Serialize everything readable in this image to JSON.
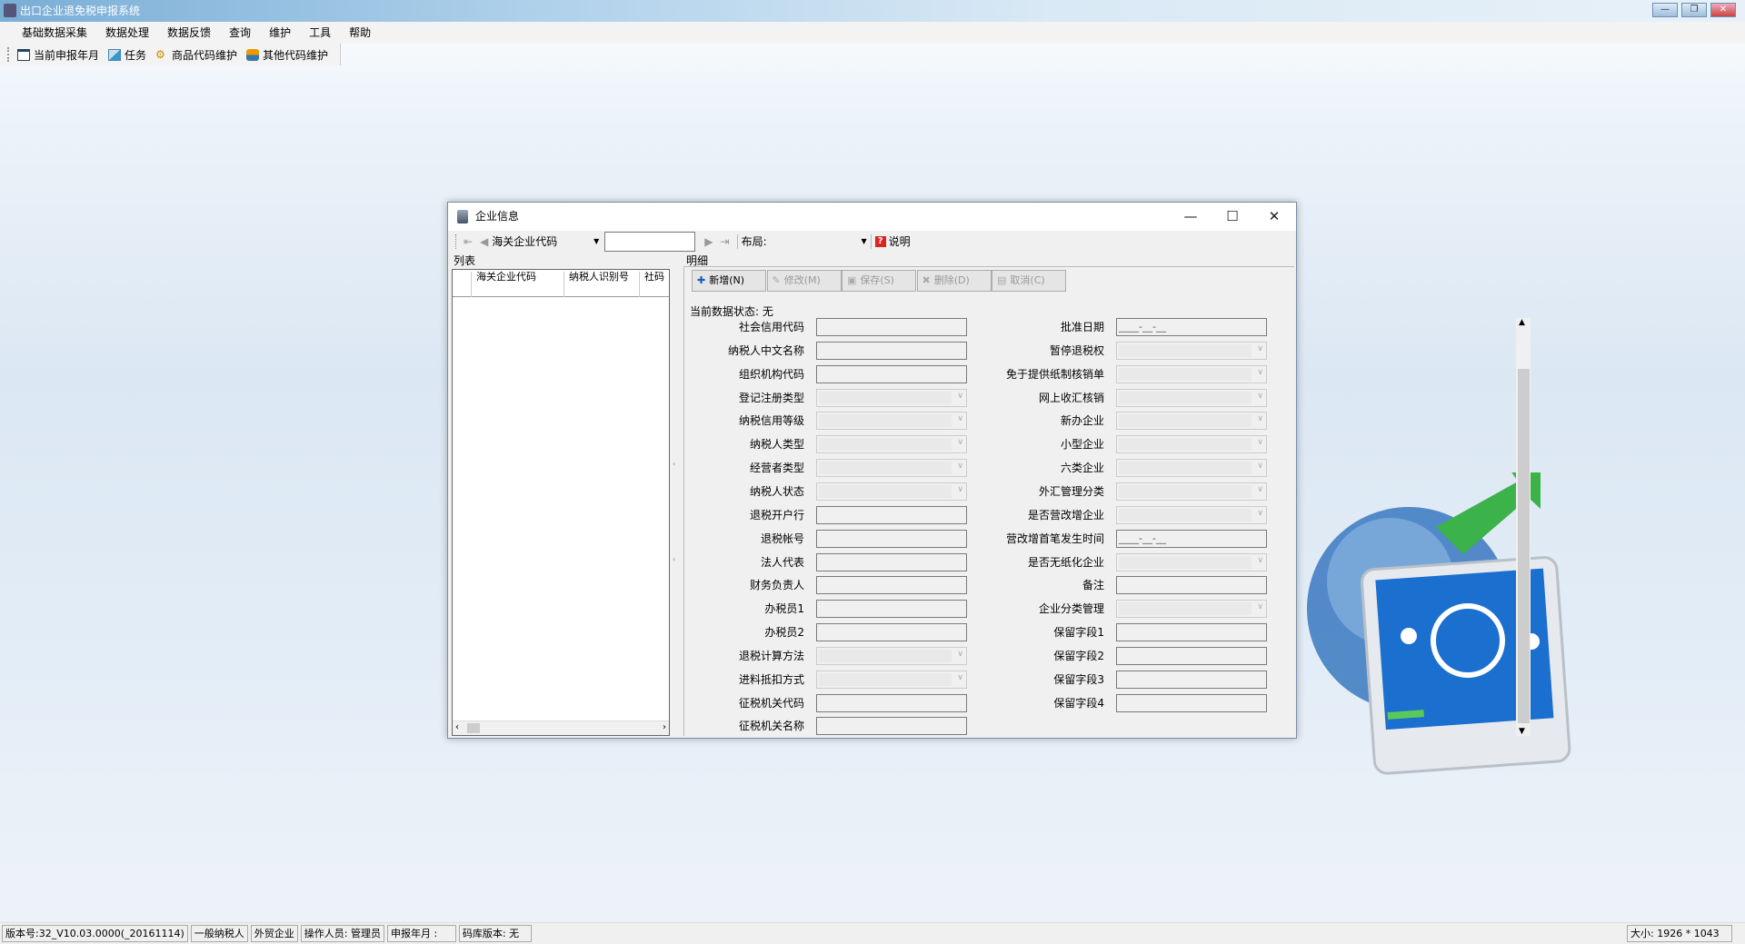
{
  "app": {
    "title": "出口企业退免税申报系统",
    "min": "—",
    "restore": "❐",
    "close": "✕"
  },
  "menu": [
    "基础数据采集",
    "数据处理",
    "数据反馈",
    "查询",
    "维护",
    "工具",
    "帮助"
  ],
  "toolbar": [
    {
      "label": "当前申报年月",
      "icon": "calendar-icon"
    },
    {
      "label": "任务",
      "icon": "task-icon"
    },
    {
      "label": "商品代码维护",
      "icon": "gear-icon"
    },
    {
      "label": "其他代码维护",
      "icon": "tools-icon"
    }
  ],
  "dialog": {
    "title": "企业信息",
    "search_field": "海关企业代码",
    "search_value": "",
    "layout_label": "布局:",
    "layout_value": "",
    "help_label": "说明",
    "list_label": "列表",
    "list_columns": [
      "海关企业代码",
      "纳税人识别号",
      "社码"
    ],
    "detail_label": "明细",
    "actions": [
      {
        "label": "新增(N)",
        "enabled": true,
        "icon": "plus-icon"
      },
      {
        "label": "修改(M)",
        "enabled": false,
        "icon": "edit-icon"
      },
      {
        "label": "保存(S)",
        "enabled": false,
        "icon": "save-icon"
      },
      {
        "label": "删除(D)",
        "enabled": false,
        "icon": "delete-icon"
      },
      {
        "label": "取消(C)",
        "enabled": false,
        "icon": "cancel-icon"
      }
    ],
    "status": "当前数据状态: 无",
    "left_fields": [
      {
        "label": "社会信用代码",
        "type": "text",
        "value": ""
      },
      {
        "label": "纳税人中文名称",
        "type": "text",
        "value": ""
      },
      {
        "label": "组织机构代码",
        "type": "text",
        "value": ""
      },
      {
        "label": "登记注册类型",
        "type": "combo",
        "value": ""
      },
      {
        "label": "纳税信用等级",
        "type": "combo",
        "value": ""
      },
      {
        "label": "纳税人类型",
        "type": "combo",
        "value": ""
      },
      {
        "label": "经营者类型",
        "type": "combo",
        "value": ""
      },
      {
        "label": "纳税人状态",
        "type": "combo",
        "value": ""
      },
      {
        "label": "退税开户行",
        "type": "text",
        "value": ""
      },
      {
        "label": "退税帐号",
        "type": "text",
        "value": ""
      },
      {
        "label": "法人代表",
        "type": "text",
        "value": ""
      },
      {
        "label": "财务负责人",
        "type": "text",
        "value": ""
      },
      {
        "label": "办税员1",
        "type": "text",
        "value": ""
      },
      {
        "label": "办税员2",
        "type": "text",
        "value": ""
      },
      {
        "label": "退税计算方法",
        "type": "combo",
        "value": ""
      },
      {
        "label": "进料抵扣方式",
        "type": "combo",
        "value": ""
      },
      {
        "label": "征税机关代码",
        "type": "text",
        "value": ""
      },
      {
        "label": "征税机关名称",
        "type": "text",
        "value": ""
      }
    ],
    "right_fields": [
      {
        "label": "批准日期",
        "type": "text",
        "value": "____-__-__"
      },
      {
        "label": "暂停退税权",
        "type": "combo",
        "value": ""
      },
      {
        "label": "免于提供纸制核销单",
        "type": "combo",
        "value": ""
      },
      {
        "label": "网上收汇核销",
        "type": "combo",
        "value": ""
      },
      {
        "label": "新办企业",
        "type": "combo",
        "value": ""
      },
      {
        "label": "小型企业",
        "type": "combo",
        "value": ""
      },
      {
        "label": "六类企业",
        "type": "combo",
        "value": ""
      },
      {
        "label": "外汇管理分类",
        "type": "combo",
        "value": ""
      },
      {
        "label": "是否营改增企业",
        "type": "combo",
        "value": ""
      },
      {
        "label": "营改增首笔发生时间",
        "type": "text",
        "value": "____-__-__"
      },
      {
        "label": "是否无纸化企业",
        "type": "combo",
        "value": ""
      },
      {
        "label": "备注",
        "type": "text",
        "value": ""
      },
      {
        "label": "企业分类管理",
        "type": "combo",
        "value": ""
      },
      {
        "label": "保留字段1",
        "type": "text",
        "value": ""
      },
      {
        "label": "保留字段2",
        "type": "text",
        "value": ""
      },
      {
        "label": "保留字段3",
        "type": "text",
        "value": ""
      },
      {
        "label": "保留字段4",
        "type": "text",
        "value": ""
      }
    ]
  },
  "statusbar": [
    "版本号:32_V10.03.0000(_20161114)",
    "一般纳税人",
    "外贸企业",
    "操作人员: 管理员",
    "申报年月 :",
    "码库版本: 无"
  ],
  "size_label": "大小: 1926 * 1043"
}
